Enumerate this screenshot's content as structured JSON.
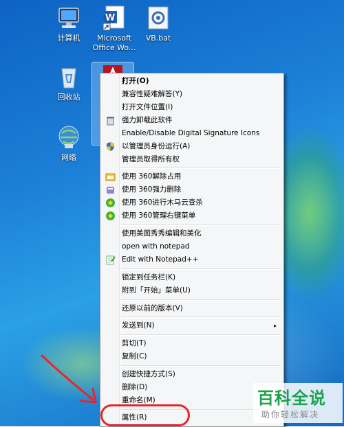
{
  "desktop_icons": [
    {
      "label_line1": "计算机",
      "label_line2": "",
      "icon": "computer-icon"
    },
    {
      "label_line1": "Microsoft",
      "label_line2": "Office Wo...",
      "icon": "word-shortcut-icon"
    },
    {
      "label_line1": "VB.bat",
      "label_line2": "",
      "icon": "batch-file-icon"
    },
    {
      "label_line1": "回收站",
      "label_line2": "",
      "icon": "recycle-bin-icon"
    },
    {
      "label_line1": "网络",
      "label_line2": "",
      "icon": "network-icon"
    }
  ],
  "context_menu": {
    "items": [
      {
        "label": "打开(O)",
        "bold": true
      },
      {
        "label": "兼容性疑难解答(Y)"
      },
      {
        "label": "打开文件位置(I)"
      },
      {
        "label": "强力卸载此软件",
        "icon": "trash-icon"
      },
      {
        "label": "Enable/Disable Digital Signature Icons"
      },
      {
        "label": "以管理员身份运行(A)",
        "icon": "uac-shield-icon"
      },
      {
        "label": "管理员取得所有权"
      },
      {
        "label": "使用 360解除占用",
        "icon": "360-unlock-icon"
      },
      {
        "label": "使用 360强力删除",
        "icon": "360-delete-icon"
      },
      {
        "label": "使用 360进行木马云查杀",
        "icon": "360-scan-icon"
      },
      {
        "label": "使用 360管理右键菜单",
        "icon": "360-menu-icon"
      },
      {
        "label": "使用美图秀秀编辑和美化"
      },
      {
        "label": "open with notepad"
      },
      {
        "label": "Edit with Notepad++",
        "icon": "notepadpp-icon"
      },
      {
        "label": "锁定到任务栏(K)"
      },
      {
        "label": "附到「开始」菜单(U)"
      },
      {
        "label": "还原以前的版本(V)"
      },
      {
        "label": "发送到(N)",
        "submenu": true
      },
      {
        "label": "剪切(T)"
      },
      {
        "label": "复制(C)"
      },
      {
        "label": "创建快捷方式(S)"
      },
      {
        "label": "删除(D)"
      },
      {
        "label": "重命名(M)"
      },
      {
        "label": "属性(R)"
      }
    ],
    "submenu_arrow": "▸"
  },
  "watermark": {
    "title": "百科全说",
    "subtitle": "助你轻松解决"
  },
  "colors": {
    "annotation_red": "#e8262a",
    "watermark_green": "#1aa34a"
  }
}
